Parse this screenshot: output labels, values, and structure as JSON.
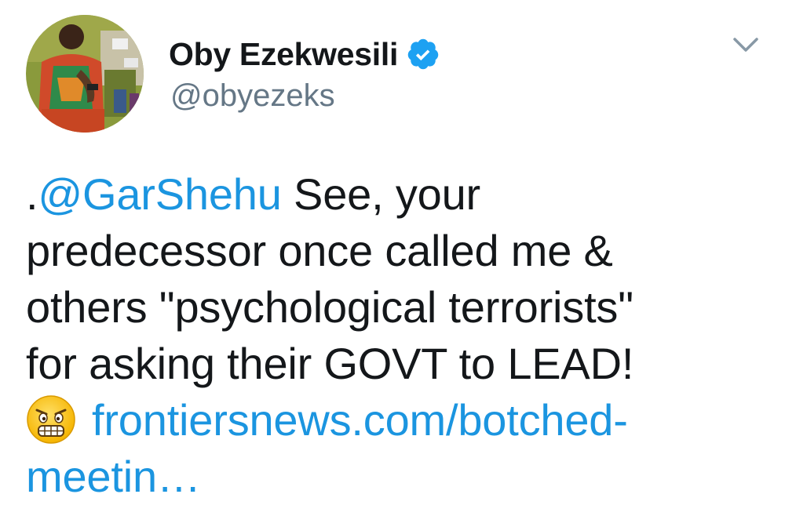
{
  "tweet": {
    "author": {
      "display_name": "Oby Ezekwesili",
      "handle": "@obyezeks",
      "verified": true,
      "avatar_icon": "profile-photo"
    },
    "menu_icon": "chevron-down-icon",
    "text": {
      "prefix": ".",
      "mention": "@GarShehu",
      "line1_rest": " See, your",
      "line2": "predecessor once called me &",
      "line3": "others \"psychological terrorists\"",
      "line4": "for asking  their GOVT to LEAD!",
      "emoji_icon": "grimacing-face-icon",
      "link_part1": "frontiersnews.com/botched-",
      "link_part2": "meetin…"
    },
    "colors": {
      "text": "#14171a",
      "secondary": "#657786",
      "link": "#1b95e0",
      "verified": "#1da1f2"
    }
  }
}
